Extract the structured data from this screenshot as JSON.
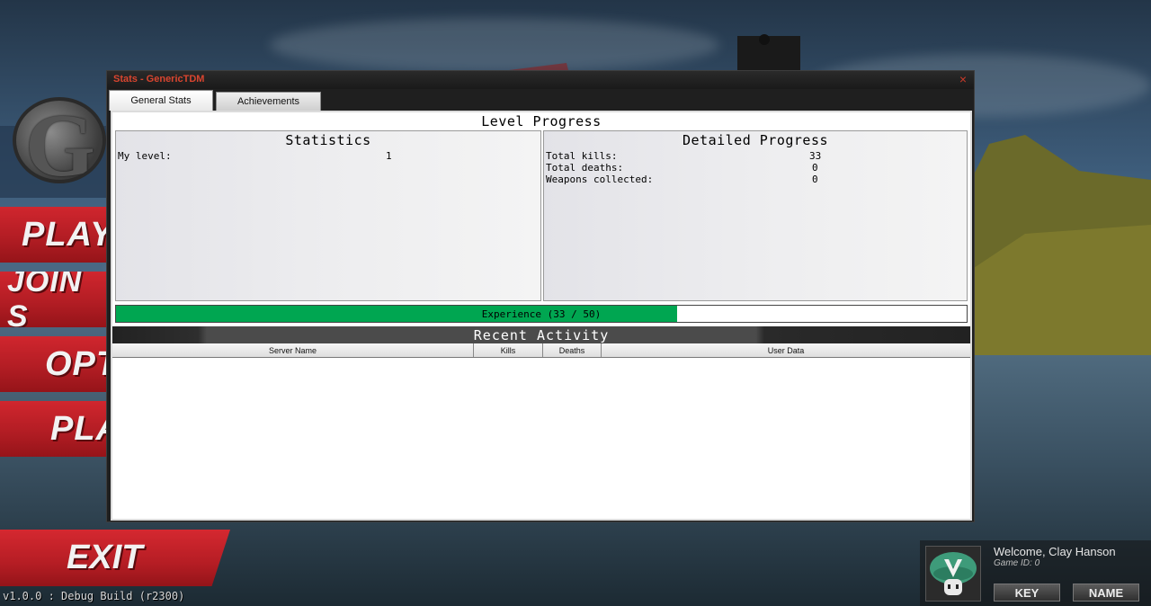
{
  "main_menu": {
    "items": [
      "PLAY",
      "JOIN S",
      "OPT",
      "PLA"
    ],
    "exit_label": "EXIT",
    "version": "v1.0.0 : Debug Build (r2300)"
  },
  "user": {
    "welcome": "Welcome, Clay Hanson",
    "game_id": "Game ID: 0",
    "key_button": "KEY",
    "name_button": "NAME"
  },
  "window": {
    "title": "Stats - GenericTDM",
    "close_glyph": "×",
    "tabs": [
      {
        "label": "General Stats",
        "active": true
      },
      {
        "label": "Achievements",
        "active": false
      }
    ]
  },
  "level_progress": {
    "title": "Level Progress",
    "statistics": {
      "title": "Statistics",
      "rows": [
        {
          "label": "My level:",
          "value": "1"
        }
      ]
    },
    "detailed": {
      "title": "Detailed Progress",
      "rows": [
        {
          "label": "Total kills:",
          "value": "33"
        },
        {
          "label": "Total deaths:",
          "value": "0"
        },
        {
          "label": "Weapons collected:",
          "value": "0"
        }
      ]
    },
    "experience": {
      "text": "Experience (33 / 50)",
      "current": 33,
      "max": 50,
      "fill_color": "#00a651"
    }
  },
  "recent_activity": {
    "title": "Recent Activity",
    "columns": [
      "Server Name",
      "Kills",
      "Deaths",
      "User Data"
    ],
    "rows": []
  },
  "colors": {
    "menu_red": "#c4222a",
    "title_red": "#d9452f",
    "window_bg": "#1f1f1f"
  }
}
